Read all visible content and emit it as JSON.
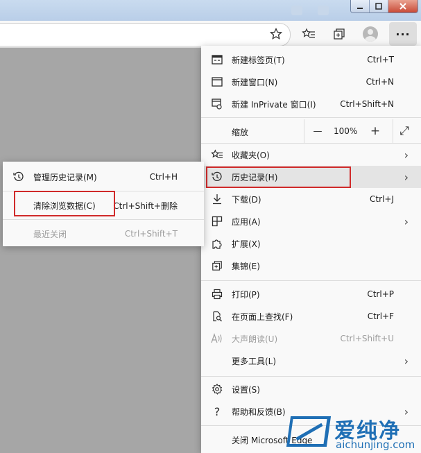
{
  "toolbar": {
    "icons": [
      "favorites-star-icon",
      "favorites-list-icon",
      "collections-icon",
      "profile-icon",
      "more-icon"
    ],
    "more_label": "···"
  },
  "main_menu": {
    "new_tab": {
      "label": "新建标签页(T)",
      "shortcut": "Ctrl+T"
    },
    "new_window": {
      "label": "新建窗口(N)",
      "shortcut": "Ctrl+N"
    },
    "new_inprivate": {
      "label": "新建 InPrivate 窗口(I)",
      "shortcut": "Ctrl+Shift+N"
    },
    "zoom": {
      "label": "缩放",
      "value": "100%",
      "minus": "—",
      "plus": "+",
      "fullscreen": "⤢"
    },
    "favorites": {
      "label": "收藏夹(O)"
    },
    "history": {
      "label": "历史记录(H)"
    },
    "downloads": {
      "label": "下载(D)",
      "shortcut": "Ctrl+J"
    },
    "apps": {
      "label": "应用(A)"
    },
    "extensions": {
      "label": "扩展(X)"
    },
    "collections": {
      "label": "集锦(E)"
    },
    "print": {
      "label": "打印(P)",
      "shortcut": "Ctrl+P"
    },
    "find": {
      "label": "在页面上查找(F)",
      "shortcut": "Ctrl+F"
    },
    "read_aloud": {
      "label": "大声朗读(U)",
      "shortcut": "Ctrl+Shift+U"
    },
    "more_tools": {
      "label": "更多工具(L)"
    },
    "settings": {
      "label": "设置(S)"
    },
    "help": {
      "label": "帮助和反馈(B)"
    },
    "close": {
      "label": "关闭 Microsoft Edge"
    },
    "chevron": "›"
  },
  "history_submenu": {
    "manage": {
      "label": "管理历史记录(M)",
      "shortcut": "Ctrl+H"
    },
    "clear": {
      "label": "清除浏览数据(C)",
      "shortcut": "Ctrl+Shift+删除"
    },
    "recently_closed": {
      "label": "最近关闭",
      "shortcut": "Ctrl+Shift+T"
    }
  },
  "watermark": {
    "cn": "爱纯净",
    "en": "aichunjing.com"
  },
  "colors": {
    "highlight_box": "#d02a2a",
    "watermark": "#1f6fb5",
    "menu_bg": "#f9f9f9"
  }
}
